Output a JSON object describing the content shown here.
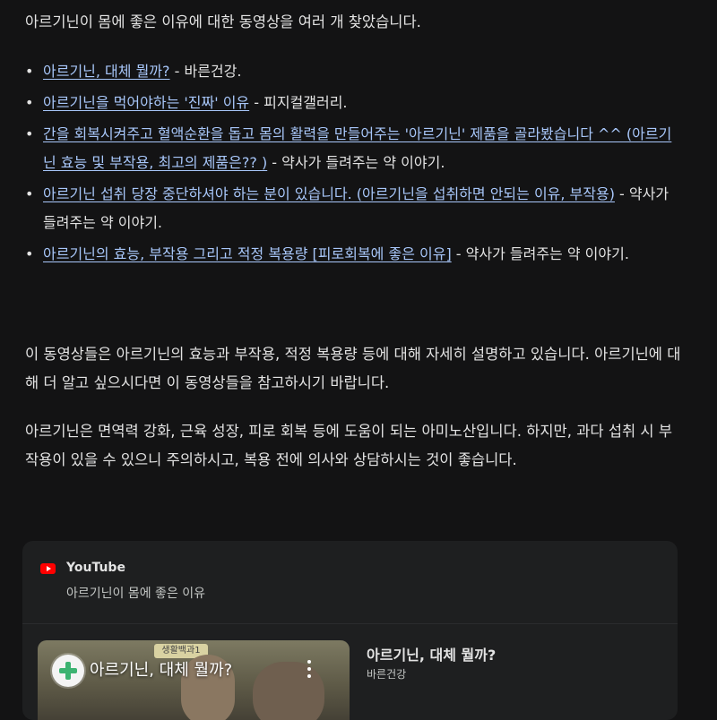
{
  "intro": "아르기닌이 몸에 좋은 이유에 대한 동영상을 여러 개 찾았습니다.",
  "links": [
    {
      "title": "아르기닌, 대체 뭘까?",
      "sep": " - ",
      "source": "바른건강."
    },
    {
      "title": "아르기닌을 먹어야하는 '진짜' 이유",
      "sep": " - ",
      "source": "피지컬갤러리."
    },
    {
      "title": "간을 회복시켜주고 혈액순환을 돕고 몸의 활력을 만들어주는 '아르기닌' 제품을 골라봤습니다 ^^ (아르기닌 효능 및 부작용, 최고의 제품은?? )",
      "sep": " - ",
      "source": "약사가 들려주는 약 이야기."
    },
    {
      "title": "아르기닌 섭취 당장 중단하셔야 하는 분이 있습니다. (아르기닌을 섭취하면 안되는 이유, 부작용)",
      "sep": " - ",
      "source": "약사가 들려주는 약 이야기."
    },
    {
      "title": "아르기닌의 효능, 부작용 그리고 적정 복용량 [피로회복에 좋은 이유]",
      "sep": " - ",
      "source": "약사가 들려주는 약 이야기."
    }
  ],
  "paragraph1": "이 동영상들은 아르기닌의 효능과 부작용, 적정 복용량 등에 대해 자세히 설명하고 있습니다. 아르기닌에 대해 더 알고 싶으시다면 이 동영상들을 참고하시기 바랍니다.",
  "paragraph2": "아르기닌은 면역력 강화, 근육 성장, 피로 회복 등에 도움이 되는 아미노산입니다. 하지만, 과다 섭취 시 부작용이 있을 수 있으니 주의하시고, 복용 전에 의사와 상담하시는 것이 좋습니다.",
  "card": {
    "provider": "YouTube",
    "query": "아르기닌이 몸에 좋은 이유",
    "video": {
      "thumb_title": "아르기닌, 대체 뭘까?",
      "thumb_sign": "생활백과1",
      "title": "아르기닌, 대체 뭘까?",
      "channel": "바른건강"
    }
  },
  "icons": {
    "provider_logo": "youtube-logo-icon",
    "menu": "kebab-menu-icon",
    "channel": "channel-avatar-icon"
  },
  "colors": {
    "background": "#131314",
    "link": "#a8c7fa",
    "card": "#1e1f20",
    "youtube_red": "#ff0000"
  }
}
